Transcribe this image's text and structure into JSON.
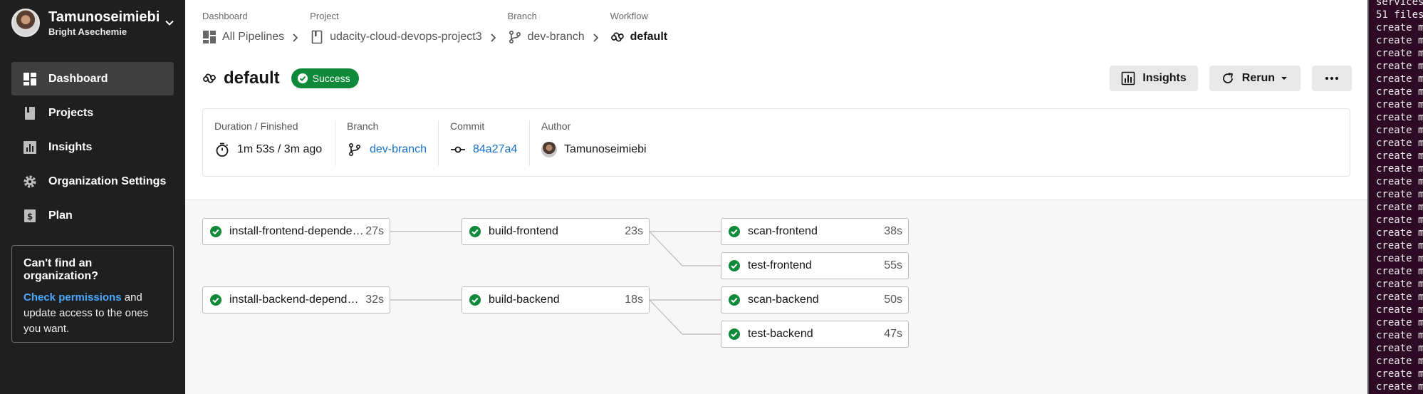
{
  "user": {
    "name": "Tamunoseimiebi",
    "subtitle": "Bright Asechemie"
  },
  "sidebar": {
    "items": [
      {
        "label": "Dashboard",
        "icon": "dashboard-icon"
      },
      {
        "label": "Projects",
        "icon": "projects-icon"
      },
      {
        "label": "Insights",
        "icon": "insights-icon"
      },
      {
        "label": "Organization Settings",
        "icon": "gear-icon"
      },
      {
        "label": "Plan",
        "icon": "plan-icon"
      }
    ],
    "help": {
      "title": "Can't find an organization?",
      "link": "Check permissions",
      "text": " and update access to the ones you want."
    }
  },
  "breadcrumb": {
    "dashboard": {
      "label": "Dashboard",
      "value": "All Pipelines"
    },
    "project": {
      "label": "Project",
      "value": "udacity-cloud-devops-project3"
    },
    "branch": {
      "label": "Branch",
      "value": "dev-branch"
    },
    "workflow": {
      "label": "Workflow",
      "value": "default"
    }
  },
  "header": {
    "title": "default",
    "status": "Success"
  },
  "actions": {
    "insights": "Insights",
    "rerun": "Rerun"
  },
  "info": {
    "duration": {
      "label": "Duration / Finished",
      "value": "1m 53s / 3m ago"
    },
    "branch": {
      "label": "Branch",
      "value": "dev-branch"
    },
    "commit": {
      "label": "Commit",
      "value": "84a27a4"
    },
    "author": {
      "label": "Author",
      "value": "Tamunoseimiebi"
    }
  },
  "jobs": [
    {
      "name": "install-frontend-dependencies",
      "time": "27s"
    },
    {
      "name": "build-frontend",
      "time": "23s"
    },
    {
      "name": "scan-frontend",
      "time": "38s"
    },
    {
      "name": "test-frontend",
      "time": "55s"
    },
    {
      "name": "install-backend-dependencies",
      "time": "32s"
    },
    {
      "name": "build-backend",
      "time": "18s"
    },
    {
      "name": "scan-backend",
      "time": "50s"
    },
    {
      "name": "test-backend",
      "time": "47s"
    }
  ],
  "terminal": {
    "lines": [
      "services",
      "51 files",
      "create m",
      "create m",
      "create m",
      "create m",
      "create m",
      "create m",
      "create m",
      "create m",
      "create m",
      "create m",
      "create m",
      "create m",
      "create m",
      "create m",
      "create m",
      "create m",
      "create m",
      "create m",
      "create m",
      "create m",
      "create m",
      "create m",
      "create m",
      "create m",
      "create m",
      "create m",
      "create m",
      "create m",
      "create m"
    ]
  },
  "colors": {
    "sidebar": "#1f1f1f",
    "success": "#0f8a3a",
    "link": "#1470c8",
    "terminal": "#2e0a25"
  }
}
